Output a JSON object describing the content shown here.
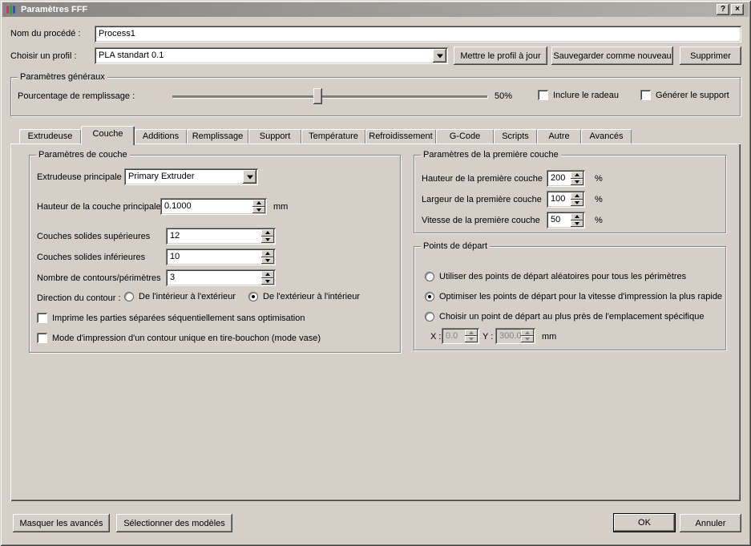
{
  "window": {
    "title": "Paramètres FFF",
    "help_glyph": "?",
    "close_glyph": "×"
  },
  "header": {
    "process_name_label": "Nom du procédé :",
    "process_name_value": "Process1",
    "profile_label": "Choisir un profil :",
    "profile_value": "PLA standart 0.1",
    "update_profile_button": "Mettre le profil à jour",
    "save_as_new_button": "Sauvegarder comme nouveau",
    "delete_button": "Supprimer"
  },
  "general": {
    "group_title": "Paramètres généraux",
    "infill_label": "Pourcentage de remplissage :",
    "infill_percent": 50,
    "infill_value": "50%",
    "raft_checkbox": "Inclure le radeau",
    "raft_checked": false,
    "support_checkbox": "Générer le support",
    "support_checked": false
  },
  "tabs": {
    "active": "Couche",
    "items": [
      {
        "label": "Extrudeuse"
      },
      {
        "label": "Couche"
      },
      {
        "label": "Additions"
      },
      {
        "label": "Remplissage"
      },
      {
        "label": "Support"
      },
      {
        "label": "Température"
      },
      {
        "label": "Refroidissement"
      },
      {
        "label": "G-Code"
      },
      {
        "label": "Scripts"
      },
      {
        "label": "Autre"
      },
      {
        "label": "Avancés"
      }
    ]
  },
  "layer": {
    "group_title": "Paramètres de couche",
    "primary_extruder_label": "Extrudeuse principale",
    "primary_extruder_value": "Primary Extruder",
    "layer_height_label": "Hauteur de la couche principale",
    "layer_height_value": "0.1000",
    "layer_height_unit": "mm",
    "top_layers_label": "Couches solides supérieures",
    "top_layers_value": "12",
    "bottom_layers_label": "Couches solides inférieures",
    "bottom_layers_value": "10",
    "outline_label": "Nombre de contours/périmètres",
    "outline_value": "3",
    "direction_label": "Direction du contour :",
    "direction_inside_out": "De l'intérieur à l'extérieur",
    "direction_outside_in": "De l'extérieur à l'intérieur",
    "direction_selected": "De l'extérieur à l'intérieur",
    "sequential_checkbox": "Imprime les parties séparées séquentiellement sans optimisation",
    "sequential_checked": false,
    "vase_checkbox": "Mode d'impression d'un contour unique en tire-bouchon (mode vase)",
    "vase_checked": false
  },
  "first_layer": {
    "group_title": "Paramètres de la première couche",
    "rows": [
      {
        "label": "Hauteur de la première couche",
        "value": "200",
        "unit": "%"
      },
      {
        "label": "Largeur de la première couche",
        "value": "100",
        "unit": "%"
      },
      {
        "label": "Vitesse de la première couche",
        "value": "50",
        "unit": "%"
      }
    ]
  },
  "start_points": {
    "group_title": "Points de départ",
    "options": [
      "Utiliser des points de départ aléatoires pour tous les périmètres",
      "Optimiser les points de départ pour la vitesse d'impression la plus rapide",
      "Choisir un point de départ au plus près de l'emplacement spécifique"
    ],
    "selected_index": 1,
    "x_label": "X :",
    "x_value": "0.0",
    "y_label": "Y :",
    "y_value": "300.0",
    "unit": "mm"
  },
  "footer": {
    "hide_advanced_button": "Masquer les avancés",
    "select_models_button": "Sélectionner des modèles",
    "ok_button": "OK",
    "cancel_button": "Annuler"
  }
}
